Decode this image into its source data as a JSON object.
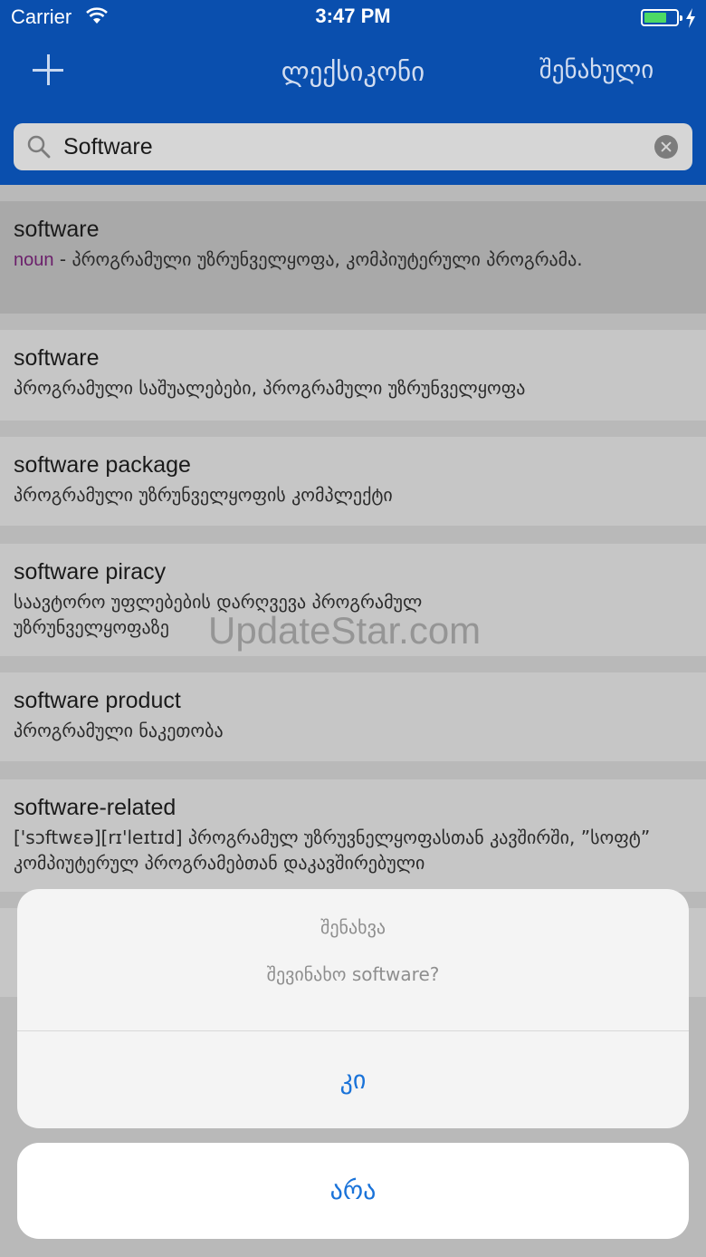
{
  "status_bar": {
    "carrier": "Carrier",
    "time": "3:47 PM",
    "battery_color": "#4cd964"
  },
  "nav": {
    "title": "ლექსიკონი",
    "saved_label": "შენახული",
    "add_icon": "plus-icon"
  },
  "search": {
    "value": "Software",
    "placeholder": ""
  },
  "results": [
    {
      "word": "software",
      "pos": "noun",
      "sep": " - ",
      "definition": "პროგრამული უზრუნველყოფა, კომპიუტერული პროგრამა."
    },
    {
      "word": "software",
      "definition": "პროგრამული საშუალებები, პროგრამული უზრუნველყოფა"
    },
    {
      "word": "software package",
      "definition": "პროგრამული უზრუნველყოფის კომპლექტი"
    },
    {
      "word": "software piracy",
      "definition": "საავტორო უფლებების დარღვევა პროგრამულ უზრუნველყოფაზე"
    },
    {
      "word": "software product",
      "definition": "პროგრამული ნაკეთობა"
    },
    {
      "word": "software-related",
      "definition": "['sɔftwɛə][rɪ'leɪtɪd] პროგრამულ უზრუვნელყოფასთან კავშირში, ”სოფტ” კომპიუტერულ პროგრამებთან დაკავშირებული"
    }
  ],
  "watermark": "UpdateStar.com",
  "alert": {
    "title": "შენახვა",
    "message": "შევინახო software?",
    "confirm_label": "კი",
    "cancel_label": "არა"
  },
  "colors": {
    "header": "#0a4fae",
    "accent": "#1a73d9"
  }
}
